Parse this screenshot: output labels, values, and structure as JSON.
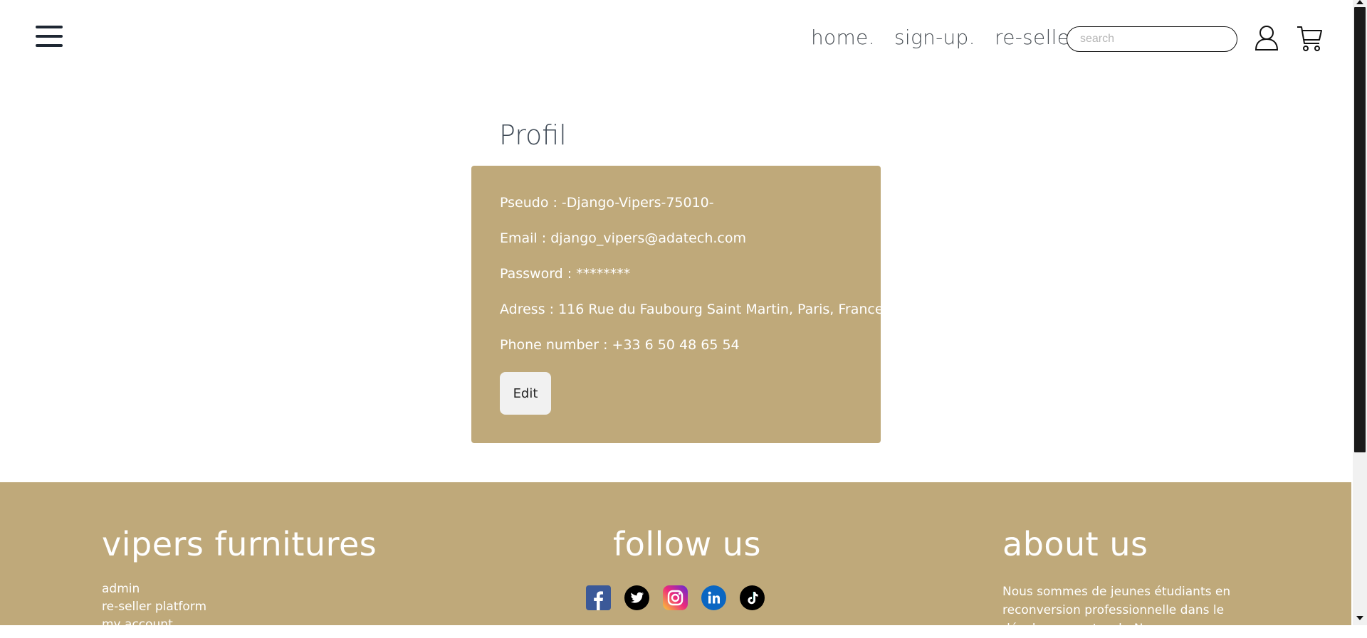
{
  "header": {
    "nav": [
      {
        "label": "home."
      },
      {
        "label": "sign-up."
      },
      {
        "label": "re-seller."
      }
    ],
    "search": {
      "placeholder": "search",
      "value": ""
    },
    "icons": {
      "menu": "hamburger-menu-icon",
      "account": "user-icon",
      "cart": "cart-icon"
    }
  },
  "main": {
    "title": "Profil",
    "fields": [
      {
        "text": "Pseudo : -Django-Vipers-75010-"
      },
      {
        "text": "Email : django_vipers@adatech.com"
      },
      {
        "text": "Password : ********"
      },
      {
        "text": "Adress : 116 Rue du Faubourg Saint Martin, Paris, France"
      },
      {
        "text": "Phone number : +33 6 50 48 65 54"
      }
    ],
    "edit_label": "Edit"
  },
  "footer": {
    "brand_title": "vipers furnitures",
    "links": [
      "admin",
      "re-seller platform",
      "my account"
    ],
    "follow_title": "follow us",
    "socials": [
      "facebook-icon",
      "twitter-icon",
      "instagram-icon",
      "linkedin-icon",
      "tiktok-icon"
    ],
    "about_title": "about us",
    "about_text": "Nous sommes de jeunes étudiants en reconversion professionnelle dans le développement web. Nous"
  },
  "colors": {
    "accent": "#bfa97a",
    "card_text": "#ffffff",
    "title": "#3f4a56",
    "scrollbar_thumb": "#1a1a1a"
  }
}
